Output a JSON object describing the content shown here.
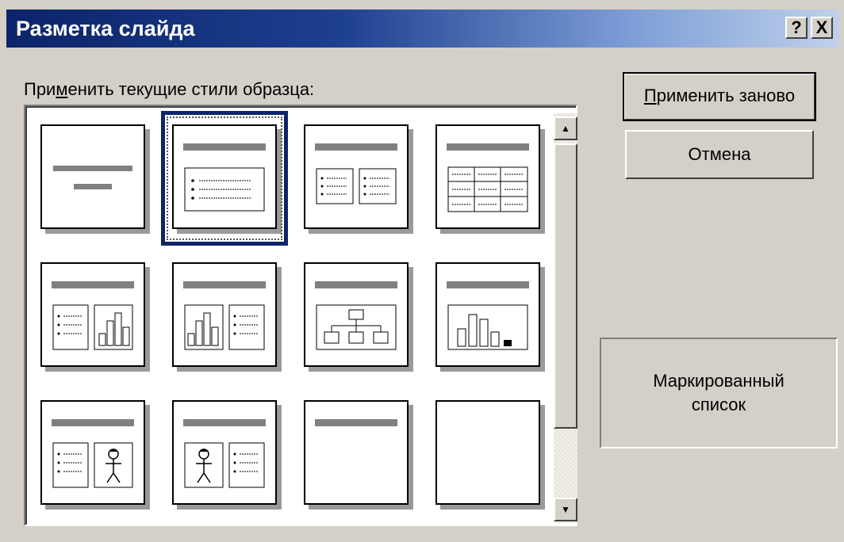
{
  "window": {
    "title": "Разметка слайда",
    "help_label": "?",
    "close_label": "X"
  },
  "caption": {
    "prefix": "При",
    "accel": "м",
    "suffix": "енить текущие стили образца:"
  },
  "buttons": {
    "apply": {
      "accel": "П",
      "rest": "рименить заново"
    },
    "cancel": "Отмена"
  },
  "description": {
    "line1": "Маркированный",
    "line2": "список"
  },
  "layouts": [
    "title-slide",
    "bulleted-list",
    "two-column-text",
    "table",
    "text-and-chart",
    "chart-and-text",
    "org-chart",
    "chart",
    "text-and-clip-art",
    "clip-art-and-text",
    "title-only",
    "blank"
  ],
  "selected_layout": "bulleted-list",
  "scrollbar": {
    "up_icon": "▲",
    "down_icon": "▼"
  }
}
